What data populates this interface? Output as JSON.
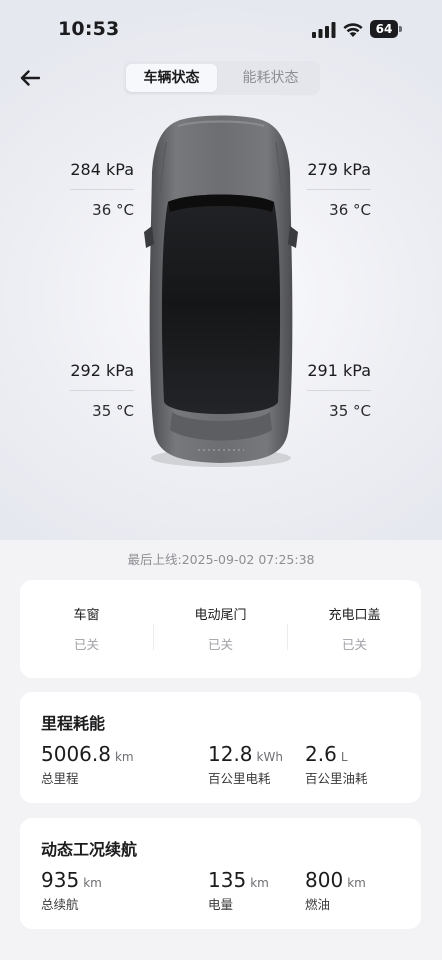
{
  "status_bar": {
    "time": "10:53",
    "battery": "64"
  },
  "tabs": [
    {
      "label": "车辆状态",
      "active": true
    },
    {
      "label": "能耗状态",
      "active": false
    }
  ],
  "tires": {
    "front_left": {
      "pressure": "284 kPa",
      "temp": "36 °C"
    },
    "front_right": {
      "pressure": "279 kPa",
      "temp": "36 °C"
    },
    "rear_left": {
      "pressure": "292 kPa",
      "temp": "35 °C"
    },
    "rear_right": {
      "pressure": "291 kPa",
      "temp": "35 °C"
    }
  },
  "last_online": "最后上线:2025-09-02 07:25:38",
  "vehicle_status": [
    {
      "label": "车窗",
      "value": "已关"
    },
    {
      "label": "电动尾门",
      "value": "已关"
    },
    {
      "label": "充电口盖",
      "value": "已关"
    }
  ],
  "mileage": {
    "title": "里程耗能",
    "metrics": [
      {
        "value": "5006.8",
        "unit": "km",
        "label": "总里程"
      },
      {
        "value": "12.8",
        "unit": "kWh",
        "label": "百公里电耗"
      },
      {
        "value": "2.6",
        "unit": "L",
        "label": "百公里油耗"
      }
    ]
  },
  "range": {
    "title": "动态工况续航",
    "metrics": [
      {
        "value": "935",
        "unit": "km",
        "label": "总续航"
      },
      {
        "value": "135",
        "unit": "km",
        "label": "电量"
      },
      {
        "value": "800",
        "unit": "km",
        "label": "燃油"
      }
    ]
  },
  "colors": {
    "background": "#f3f3f6",
    "card": "#ffffff",
    "car_body": "#6b6c6e",
    "glass": "#1a1b1d"
  },
  "icons": {
    "back": "arrow-left-icon",
    "signal": "cellular-signal-icon",
    "wifi": "wifi-icon",
    "battery": "battery-icon"
  }
}
